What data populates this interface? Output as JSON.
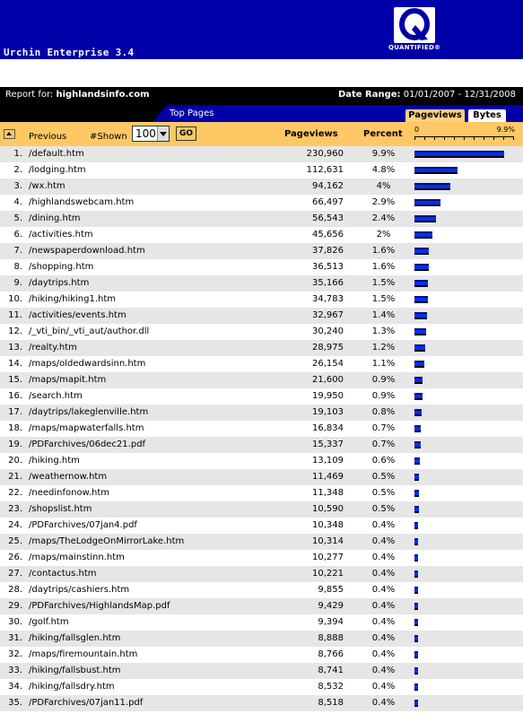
{
  "app": {
    "title": "Urchin Enterprise 3.4",
    "logo_text": "QUANTIFIED®"
  },
  "report": {
    "label": "Report for:",
    "site": "highlandsinfo.com",
    "date_label": "Date Range:",
    "date_range": "01/01/2007 - 12/31/2008"
  },
  "tabs": {
    "section": "Top Pages",
    "pageviews": "Pageviews",
    "bytes": "Bytes"
  },
  "controls": {
    "previous": "Previous",
    "shown_label": "#Shown",
    "shown_value": "100",
    "go": "GO",
    "col_pageviews": "Pageviews",
    "col_percent": "Percent",
    "scale_min": "0",
    "scale_max": "9.9%"
  },
  "colors": {
    "header": "#0000a8",
    "control_bar": "#ffc864",
    "bar": "#0030f0"
  },
  "rows": [
    {
      "rank": "1.",
      "page": "/default.htm",
      "pageviews": "230,960",
      "percent": "9.9%",
      "pct": 9.9
    },
    {
      "rank": "2.",
      "page": "/lodging.htm",
      "pageviews": "112,631",
      "percent": "4.8%",
      "pct": 4.8
    },
    {
      "rank": "3.",
      "page": "/wx.htm",
      "pageviews": "94,162",
      "percent": "4%",
      "pct": 4.0
    },
    {
      "rank": "4.",
      "page": "/highlandswebcam.htm",
      "pageviews": "66,497",
      "percent": "2.9%",
      "pct": 2.9
    },
    {
      "rank": "5.",
      "page": "/dining.htm",
      "pageviews": "56,543",
      "percent": "2.4%",
      "pct": 2.4
    },
    {
      "rank": "6.",
      "page": "/activities.htm",
      "pageviews": "45,656",
      "percent": "2%",
      "pct": 2.0
    },
    {
      "rank": "7.",
      "page": "/newspaperdownload.htm",
      "pageviews": "37,826",
      "percent": "1.6%",
      "pct": 1.6
    },
    {
      "rank": "8.",
      "page": "/shopping.htm",
      "pageviews": "36,513",
      "percent": "1.6%",
      "pct": 1.6
    },
    {
      "rank": "9.",
      "page": "/daytrips.htm",
      "pageviews": "35,166",
      "percent": "1.5%",
      "pct": 1.5
    },
    {
      "rank": "10.",
      "page": "/hiking/hiking1.htm",
      "pageviews": "34,783",
      "percent": "1.5%",
      "pct": 1.5
    },
    {
      "rank": "11.",
      "page": "/activities/events.htm",
      "pageviews": "32,967",
      "percent": "1.4%",
      "pct": 1.4
    },
    {
      "rank": "12.",
      "page": "/_vti_bin/_vti_aut/author.dll",
      "pageviews": "30,240",
      "percent": "1.3%",
      "pct": 1.3
    },
    {
      "rank": "13.",
      "page": "/realty.htm",
      "pageviews": "28,975",
      "percent": "1.2%",
      "pct": 1.2
    },
    {
      "rank": "14.",
      "page": "/maps/oldedwardsinn.htm",
      "pageviews": "26,154",
      "percent": "1.1%",
      "pct": 1.1
    },
    {
      "rank": "15.",
      "page": "/maps/mapit.htm",
      "pageviews": "21,600",
      "percent": "0.9%",
      "pct": 0.9
    },
    {
      "rank": "16.",
      "page": "/search.htm",
      "pageviews": "19,950",
      "percent": "0.9%",
      "pct": 0.9
    },
    {
      "rank": "17.",
      "page": "/daytrips/lakeglenville.htm",
      "pageviews": "19,103",
      "percent": "0.8%",
      "pct": 0.8
    },
    {
      "rank": "18.",
      "page": "/maps/mapwaterfalls.htm",
      "pageviews": "16,834",
      "percent": "0.7%",
      "pct": 0.7
    },
    {
      "rank": "19.",
      "page": "/PDFarchives/06dec21.pdf",
      "pageviews": "15,337",
      "percent": "0.7%",
      "pct": 0.7
    },
    {
      "rank": "20.",
      "page": "/hiking.htm",
      "pageviews": "13,109",
      "percent": "0.6%",
      "pct": 0.6
    },
    {
      "rank": "21.",
      "page": "/weathernow.htm",
      "pageviews": "11,469",
      "percent": "0.5%",
      "pct": 0.5
    },
    {
      "rank": "22.",
      "page": "/needinfonow.htm",
      "pageviews": "11,348",
      "percent": "0.5%",
      "pct": 0.5
    },
    {
      "rank": "23.",
      "page": "/shopslist.htm",
      "pageviews": "10,590",
      "percent": "0.5%",
      "pct": 0.5
    },
    {
      "rank": "24.",
      "page": "/PDFarchives/07jan4.pdf",
      "pageviews": "10,348",
      "percent": "0.4%",
      "pct": 0.4
    },
    {
      "rank": "25.",
      "page": "/maps/TheLodgeOnMirrorLake.htm",
      "pageviews": "10,314",
      "percent": "0.4%",
      "pct": 0.4
    },
    {
      "rank": "26.",
      "page": "/maps/mainstinn.htm",
      "pageviews": "10,277",
      "percent": "0.4%",
      "pct": 0.4
    },
    {
      "rank": "27.",
      "page": "/contactus.htm",
      "pageviews": "10,221",
      "percent": "0.4%",
      "pct": 0.4
    },
    {
      "rank": "28.",
      "page": "/daytrips/cashiers.htm",
      "pageviews": "9,855",
      "percent": "0.4%",
      "pct": 0.4
    },
    {
      "rank": "29.",
      "page": "/PDFarchives/HighlandsMap.pdf",
      "pageviews": "9,429",
      "percent": "0.4%",
      "pct": 0.4
    },
    {
      "rank": "30.",
      "page": "/golf.htm",
      "pageviews": "9,394",
      "percent": "0.4%",
      "pct": 0.4
    },
    {
      "rank": "31.",
      "page": "/hiking/fallsglen.htm",
      "pageviews": "8,888",
      "percent": "0.4%",
      "pct": 0.4
    },
    {
      "rank": "32.",
      "page": "/maps/firemountain.htm",
      "pageviews": "8,766",
      "percent": "0.4%",
      "pct": 0.4
    },
    {
      "rank": "33.",
      "page": "/hiking/fallsbust.htm",
      "pageviews": "8,741",
      "percent": "0.4%",
      "pct": 0.4
    },
    {
      "rank": "34.",
      "page": "/hiking/fallsdry.htm",
      "pageviews": "8,532",
      "percent": "0.4%",
      "pct": 0.4
    },
    {
      "rank": "35.",
      "page": "/PDFarchives/07jan11.pdf",
      "pageviews": "8,518",
      "percent": "0.4%",
      "pct": 0.4
    }
  ]
}
